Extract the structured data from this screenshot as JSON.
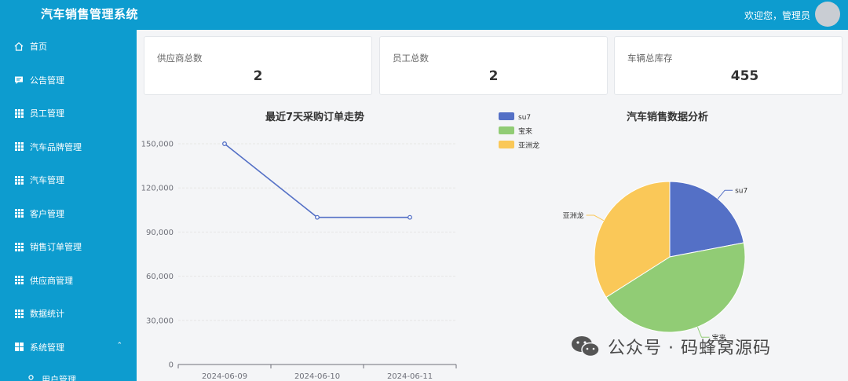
{
  "header": {
    "title": "汽车销售管理系统",
    "welcome": "欢迎您，管理员"
  },
  "sidebar": {
    "items": [
      {
        "label": "首页"
      },
      {
        "label": "公告管理"
      },
      {
        "label": "员工管理"
      },
      {
        "label": "汽车品牌管理"
      },
      {
        "label": "汽车管理"
      },
      {
        "label": "客户管理"
      },
      {
        "label": "销售订单管理"
      },
      {
        "label": "供应商管理"
      },
      {
        "label": "数据统计"
      },
      {
        "label": "系统管理"
      }
    ],
    "sub_items": [
      {
        "label": "用户管理"
      }
    ]
  },
  "stats": [
    {
      "label": "供应商总数",
      "value": "2"
    },
    {
      "label": "员工总数",
      "value": "2"
    },
    {
      "label": "车辆总库存",
      "value": "455"
    }
  ],
  "chart_data": [
    {
      "type": "line",
      "title": "最近7天采购订单走势",
      "categories": [
        "2024-06-09",
        "2024-06-10",
        "2024-06-11"
      ],
      "series": [
        {
          "values": [
            150000,
            100000,
            100000
          ]
        }
      ],
      "ylim": [
        0,
        150000
      ],
      "yticks": [
        "0",
        "30,000",
        "60,000",
        "90,000",
        "120,000",
        "150,000"
      ],
      "grid": true,
      "color": "#5470c6"
    },
    {
      "type": "pie",
      "title": "汽车销售数据分析",
      "legend_position": "top-left",
      "slices": [
        {
          "name": "su7",
          "value": 22,
          "color": "#5470c6"
        },
        {
          "name": "宝来",
          "value": 44,
          "color": "#91cc75"
        },
        {
          "name": "亚洲龙",
          "value": 34,
          "color": "#fac858"
        }
      ]
    }
  ],
  "watermark": {
    "text": "公众号 · 码蜂窝源码"
  }
}
